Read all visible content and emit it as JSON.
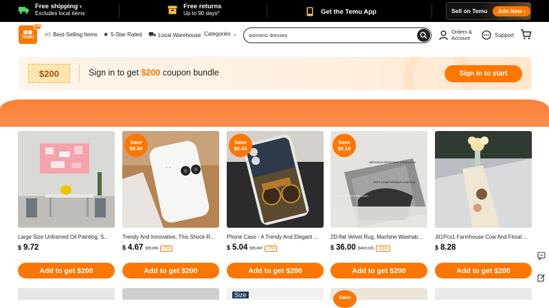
{
  "topbar": {
    "free_shipping": {
      "title": "Free shipping",
      "sub": "Excludes local items"
    },
    "free_returns": {
      "title": "Free returns",
      "sub": "Up to 90 days*"
    },
    "app": {
      "title": "Get the Temu App"
    },
    "sell": {
      "label": "Sell on Temu",
      "button": "Join Now"
    }
  },
  "header": {
    "logo_text": "TEMU",
    "logo_region": "US",
    "nav": [
      {
        "label": "Best-Selling Items",
        "icon": "thumbs-up-icon"
      },
      {
        "label": "5-Star Rated",
        "icon": "star-badge-icon"
      },
      {
        "label": "Local Warehouse",
        "icon": "truck-icon"
      },
      {
        "label": "Categories",
        "icon": "chevron-down-icon"
      }
    ],
    "search_value": "womens dresses",
    "orders_line1": "Orders &",
    "orders_line2": "Account",
    "support": "Support"
  },
  "banner": {
    "coupon": "$200",
    "text_pre": "Sign in to get ",
    "text_amt": "$200",
    "text_post": " coupon bundle",
    "button": "Sign in to start"
  },
  "products": [
    {
      "title": "Large Size Unframed Oil Painting, S...",
      "currency": "$",
      "price": "9.72",
      "original": "",
      "discount": "",
      "save_label": "",
      "save_amount": "",
      "button": "Add to get $200"
    },
    {
      "title": "Trendy And Innovative, This Shock-R...",
      "currency": "$",
      "price": "4.67",
      "original": "$5.06",
      "discount": "-7%",
      "save_label": "Save",
      "save_amount": "$0.39",
      "button": "Add to get $200"
    },
    {
      "title": "Phone Case - A Trendy And Elegant ...",
      "currency": "$",
      "price": "5.04",
      "original": "$5.47",
      "discount": "-7%",
      "save_label": "Save",
      "save_amount": "$0.43",
      "button": "Add to get $200"
    },
    {
      "title": "2D-flat Velvet Rug, Machine Washab...",
      "currency": "$",
      "price": "36.00",
      "original": "$41.16",
      "discount": "-12%",
      "save_label": "Save",
      "save_amount": "$5.16",
      "button": "Add to get $200"
    },
    {
      "title": "Jit1Pcs1 Farmhouse Cow And Floral ...",
      "currency": "$",
      "price": "8.28",
      "original": "",
      "discount": "",
      "save_label": "",
      "save_amount": "",
      "button": "Add to get $200"
    }
  ],
  "rug_labels": [
    "ABRASION RESISTANT EDGE LOCK",
    "SOFT COMFORTABLE LOW PILE",
    "NON-SLIP TPE BACKING"
  ],
  "bottom_row": {
    "size_tag": "Size",
    "save_label": "Save"
  },
  "colors": {
    "accent": "#fb7701",
    "topbar": "#000000"
  }
}
